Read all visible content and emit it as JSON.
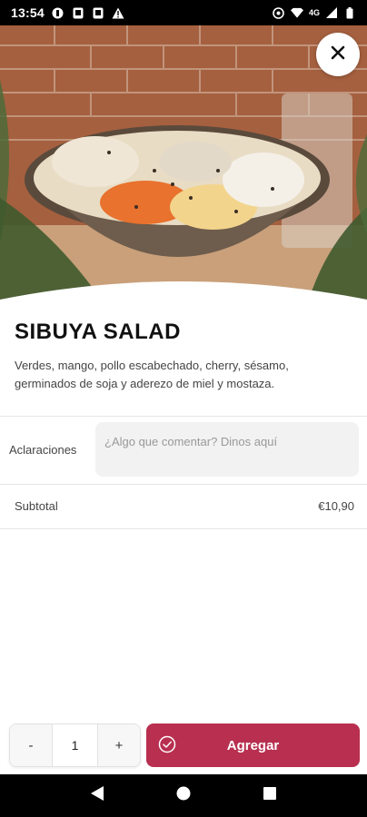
{
  "status_bar": {
    "time": "13:54",
    "network": "4G"
  },
  "product": {
    "title": "SIBUYA SALAD",
    "description": "Verdes, mango, pollo escabechado, cherry, sésamo, germinados de soja y aderezo de miel y mostaza."
  },
  "notes": {
    "label": "Aclaraciones",
    "placeholder": "¿Algo que comentar? Dinos aquí"
  },
  "subtotal": {
    "label": "Subtotal",
    "value": "€10,90"
  },
  "quantity": {
    "minus_label": "-",
    "value": "1",
    "plus_label": "+"
  },
  "add_button": {
    "label": "Agregar"
  },
  "colors": {
    "accent": "#b82f4f",
    "status_bar_bg": "#000000",
    "nav_bar_bg": "#000000"
  },
  "icons": {
    "close": "close-icon",
    "add_check": "check-circle-icon",
    "nav_back": "back-triangle-icon",
    "nav_home": "home-circle-icon",
    "nav_recents": "recents-square-icon"
  }
}
